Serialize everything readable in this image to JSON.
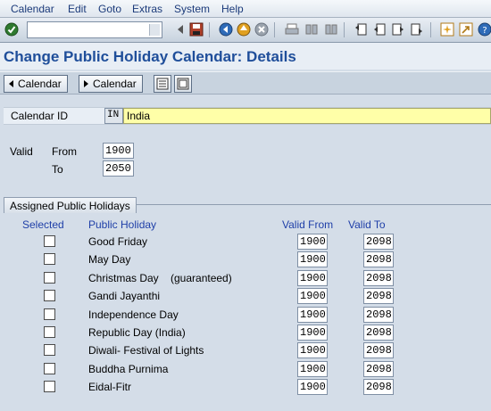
{
  "menu": [
    "Calendar",
    "Edit",
    "Goto",
    "Extras",
    "System",
    "Help"
  ],
  "command_field": {
    "value": ""
  },
  "title": "Change Public Holiday Calendar: Details",
  "app_toolbar": {
    "prev_label": "Calendar",
    "next_label": "Calendar"
  },
  "header": {
    "calendar_id_label": "Calendar ID",
    "calendar_id": "IN",
    "calendar_name": "India",
    "valid_label": "Valid",
    "from_label": "From",
    "from_value": "1900",
    "to_label": "To",
    "to_value": "2050"
  },
  "group_title": "Assigned Public Holidays",
  "columns": {
    "selected": "Selected",
    "holiday": "Public Holiday",
    "valid_from": "Valid From",
    "valid_to": "Valid To"
  },
  "holidays": [
    {
      "name": "Good Friday",
      "from": "1900",
      "to": "2098"
    },
    {
      "name": "May Day",
      "from": "1900",
      "to": "2098"
    },
    {
      "name": "Christmas Day    (guaranteed)",
      "from": "1900",
      "to": "2098"
    },
    {
      "name": "Gandi Jayanthi",
      "from": "1900",
      "to": "2098"
    },
    {
      "name": "Independence Day",
      "from": "1900",
      "to": "2098"
    },
    {
      "name": "Republic Day (India)",
      "from": "1900",
      "to": "2098"
    },
    {
      "name": "Diwali- Festival of Lights",
      "from": "1900",
      "to": "2098"
    },
    {
      "name": "Buddha Purnima",
      "from": "1900",
      "to": "2098"
    },
    {
      "name": "Eidal-Fitr",
      "from": "1900",
      "to": "2098"
    }
  ],
  "colors": {
    "title": "#1f4e9a",
    "header_text": "#1f3fa8",
    "name_field": "#ffffa8"
  }
}
